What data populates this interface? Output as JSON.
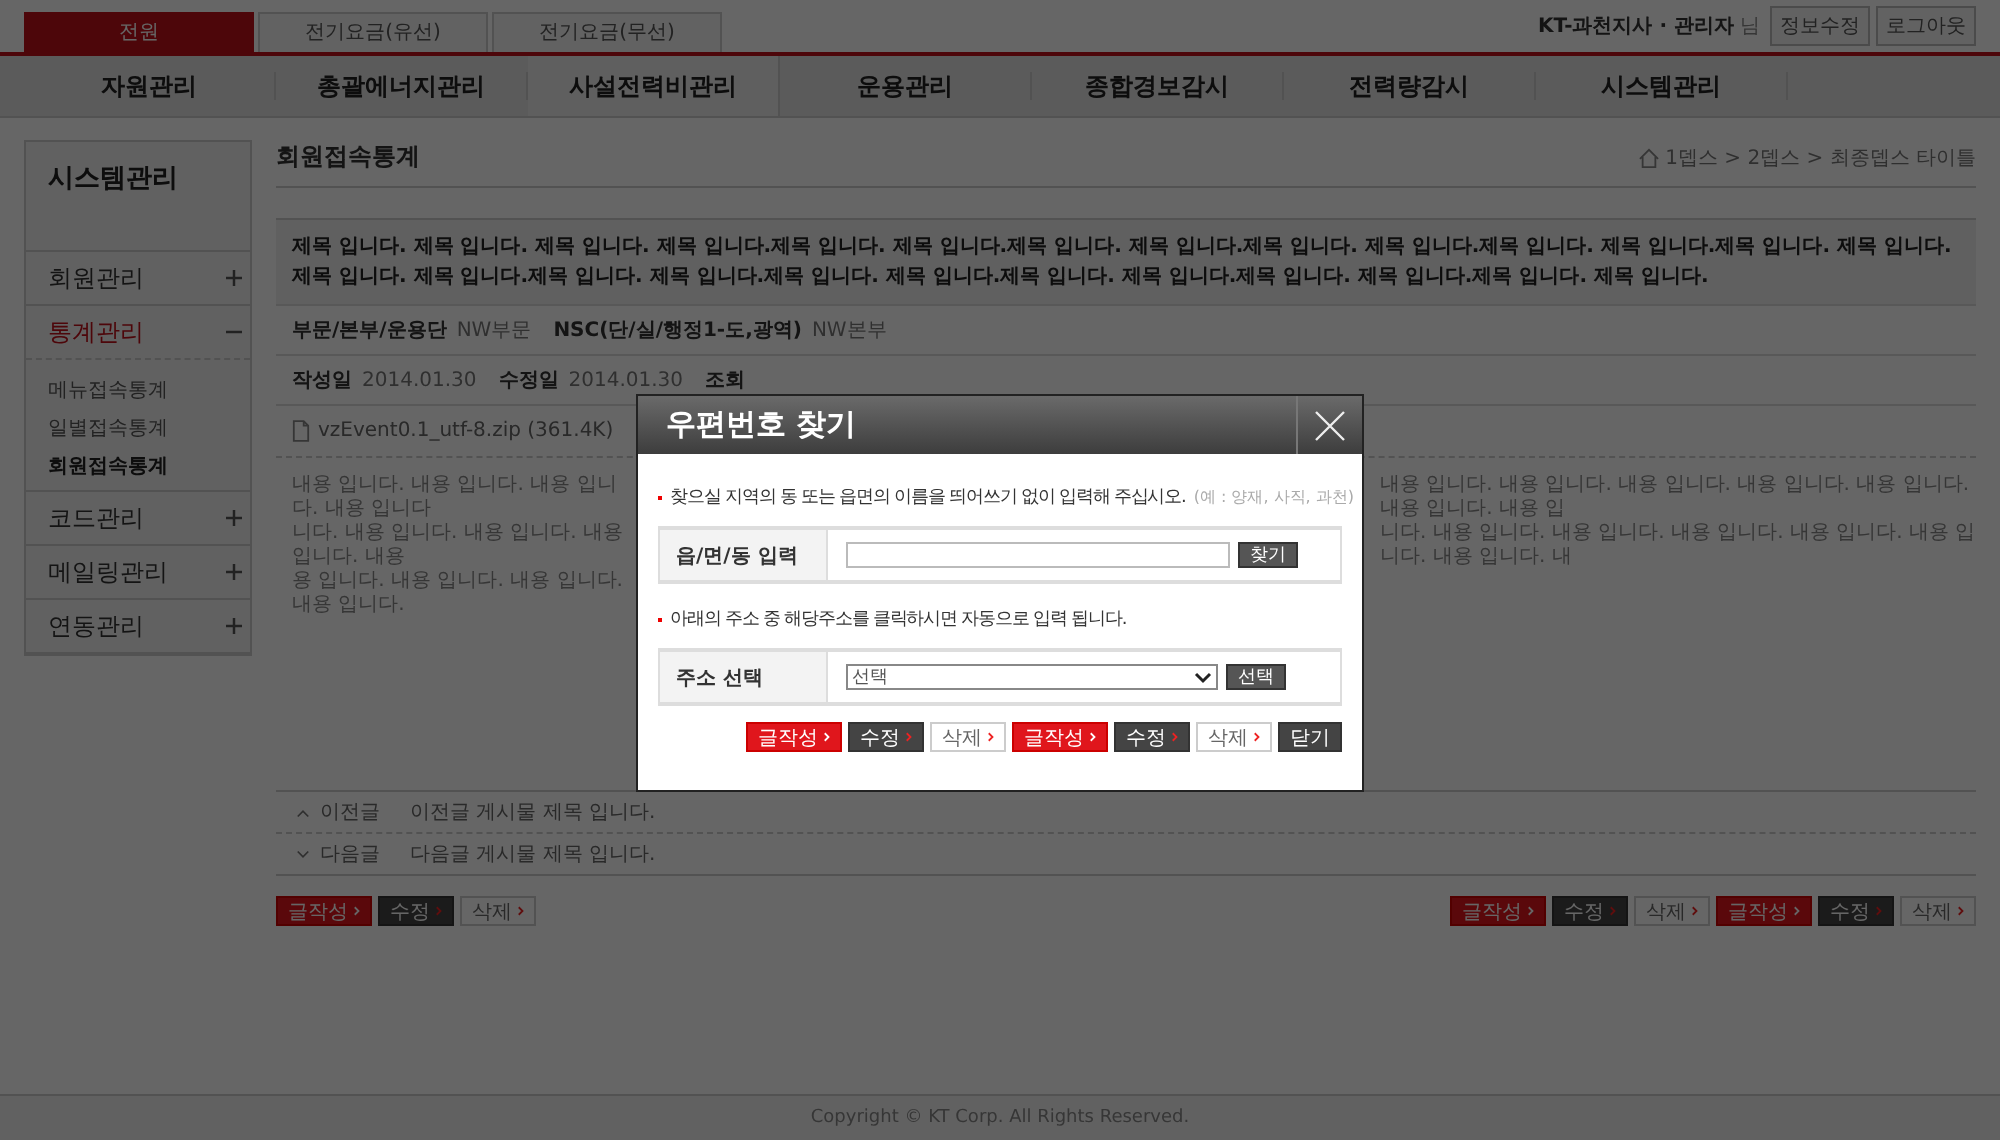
{
  "top_tabs": [
    {
      "label": "전원",
      "selected": true
    },
    {
      "label": "전기요금(유선)",
      "selected": false
    },
    {
      "label": "전기요금(무선)",
      "selected": false
    }
  ],
  "user": {
    "name": "KT-과천지사 · 관리자",
    "suffix": "님",
    "buttons": [
      "정보수정",
      "로그아웃"
    ]
  },
  "nav": [
    {
      "label": "자원관리",
      "selected": false
    },
    {
      "label": "총괄에너지관리",
      "selected": false
    },
    {
      "label": "사설전력비관리",
      "selected": true
    },
    {
      "label": "운용관리",
      "selected": false
    },
    {
      "label": "종합경보감시",
      "selected": false
    },
    {
      "label": "전력량감시",
      "selected": false
    },
    {
      "label": "시스템관리",
      "selected": false
    }
  ],
  "sidebar": {
    "title": "시스템관리",
    "items": [
      {
        "label": "회원관리",
        "expanded": false,
        "selected": false
      },
      {
        "label": "통계관리",
        "expanded": true,
        "selected": true,
        "children": [
          {
            "label": "메뉴접속통계",
            "selected": false
          },
          {
            "label": "일별접속통계",
            "selected": false
          },
          {
            "label": "회원접속통계",
            "selected": true
          }
        ]
      },
      {
        "label": "코드관리",
        "expanded": false,
        "selected": false
      },
      {
        "label": "메일링관리",
        "expanded": false,
        "selected": false
      },
      {
        "label": "연동관리",
        "expanded": false,
        "selected": false
      }
    ]
  },
  "content": {
    "title": "회원접속통계",
    "breadcrumb": "1뎁스 > 2뎁스 > 최종뎁스 타이틀",
    "heading": "제목 입니다. 제목 입니다. 제목 입니다. 제목 입니다.제목 입니다. 제목 입니다.제목 입니다. 제목 입니다.제목 입니다. 제목 입니다.제목 입니다. 제목 입니다.제목 입니다. 제목 입니다.제목 입니다. 제목 입니다.제목 입니다. 제목 입니다.제목 입니다. 제목 입니다.제목 입니다. 제목 입니다.제목 입니다. 제목 입니다.제목 입니다. 제목 입니다.",
    "info": [
      {
        "label": "부문/본부/운용단",
        "value": "NW부문"
      },
      {
        "label": "NSC(단/실/행정1-도,광역)",
        "value": "NW본부"
      }
    ],
    "meta": [
      {
        "label": "작성일",
        "value": "2014.01.30"
      },
      {
        "label": "수정일",
        "value": "2014.01.30"
      },
      {
        "label": "조회"
      }
    ],
    "file": "vzEvent0.1_utf-8.zip (361.4K)",
    "body_left": [
      "내용 입니다. 내용 입니다. 내용 입니다. 내용 입니다",
      "니다. 내용 입니다. 내용 입니다. 내용 입니다. 내용",
      "용 입니다. 내용 입니다. 내용 입니다. 내용 입니다."
    ],
    "body_right": [
      "내용 입니다. 내용 입니다. 내용 입니다. 내용 입니다. 내용 입니다. 내용 입니다. 내용 입",
      "니다. 내용 입니다. 내용 입니다. 내용 입니다. 내용 입니다. 내용 입니다. 내용 입니다. 내"
    ],
    "prev_next": [
      {
        "kind": "prev",
        "label": "이전글",
        "title": "이전글 게시물 제목 입니다."
      },
      {
        "kind": "next",
        "label": "다음글",
        "title": "다음글 게시물 제목 입니다."
      }
    ],
    "buttons_left": [
      {
        "label": "글작성",
        "kind": "write"
      },
      {
        "label": "수정",
        "kind": "edit"
      },
      {
        "label": "삭제",
        "kind": "delete"
      }
    ],
    "buttons_right": [
      {
        "label": "글작성",
        "kind": "write"
      },
      {
        "label": "수정",
        "kind": "edit"
      },
      {
        "label": "삭제",
        "kind": "delete"
      },
      {
        "label": "글작성",
        "kind": "write"
      },
      {
        "label": "수정",
        "kind": "edit"
      },
      {
        "label": "삭제",
        "kind": "delete"
      }
    ]
  },
  "footer": "Copyright © KT Corp. All Rights Reserved.",
  "dialog": {
    "title": "우편번호 찾기",
    "instruction": "찾으실 지역의 동 또는 읍면의 이름을 띄어쓰기 없이 입력해 주십시오.",
    "hint": "(예 : 양재, 사직, 과천)",
    "search_label": "읍/면/동 입력",
    "search_button": "찾기",
    "instruction2": "아래의 주소 중 해당주소를 클릭하시면 자동으로 입력 됩니다.",
    "select_label": "주소 선택",
    "select_value": "선택",
    "select_button": "선택",
    "buttons": [
      {
        "label": "글작성",
        "kind": "write"
      },
      {
        "label": "수정",
        "kind": "edit"
      },
      {
        "label": "삭제",
        "kind": "delete"
      },
      {
        "label": "글작성",
        "kind": "write"
      },
      {
        "label": "수정",
        "kind": "edit"
      },
      {
        "label": "삭제",
        "kind": "delete"
      },
      {
        "label": "닫기",
        "kind": "close"
      }
    ]
  }
}
